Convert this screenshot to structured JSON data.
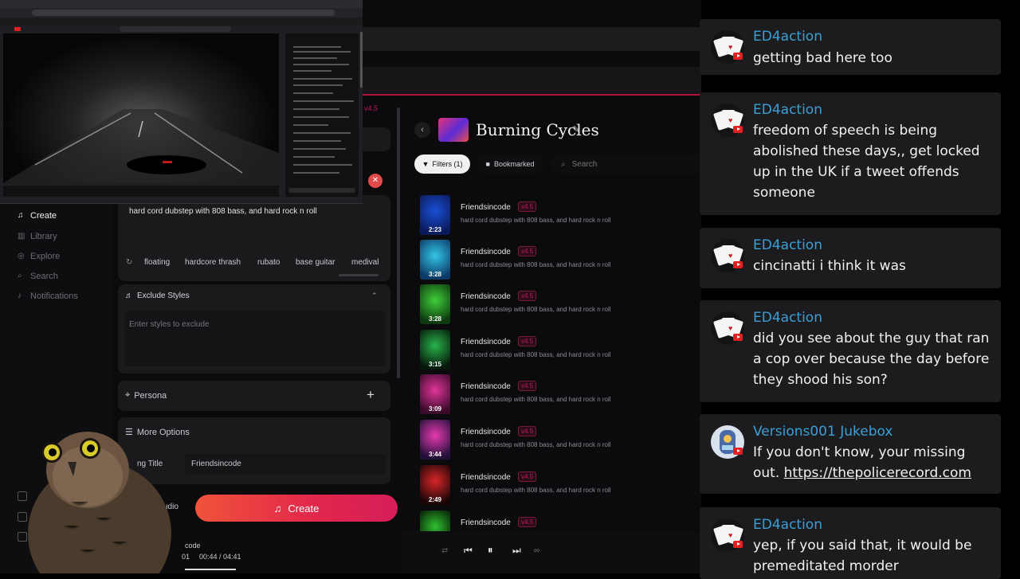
{
  "window": {
    "playlist_title": "Burning Cycles",
    "version_badge": "v4.5"
  },
  "sidebar": {
    "items": [
      {
        "label": "Create",
        "icon": "music-note-icon",
        "active": true
      },
      {
        "label": "Library",
        "icon": "library-icon"
      },
      {
        "label": "Explore",
        "icon": "compass-icon"
      },
      {
        "label": "Search",
        "icon": "search-icon"
      },
      {
        "label": "Notifications",
        "icon": "bell-icon"
      }
    ]
  },
  "form": {
    "prompt_text": "hard cord dubstep with 808 bass, and hard rock n roll",
    "style_tags": [
      "floating",
      "hardcore thrash",
      "rubato",
      "base guitar",
      "medival"
    ],
    "exclude_styles_label": "Exclude Styles",
    "exclude_placeholder": "Enter styles to exclude",
    "persona_label": "Persona",
    "more_options_label": "More Options",
    "song_title_label": "ng Title",
    "song_title_value": "Friendsincode",
    "audio_label": "udio",
    "create_label": "Create",
    "player_track_fragment": "code",
    "player_time": "00:44 / 04:41",
    "player_index": "01"
  },
  "toolbar": {
    "filters_label": "Filters (1)",
    "bookmarked_label": "Bookmarked",
    "search_placeholder": "Search"
  },
  "songs": [
    {
      "title": "Friendsincode",
      "badge": "v4.5",
      "desc": "hard cord dubstep with 808 bass, and hard rock n roll",
      "duration": "2:23",
      "color1": "#1a4fd6",
      "color2": "#0a1a5a"
    },
    {
      "title": "Friendsincode",
      "badge": "v4.5",
      "desc": "hard cord dubstep with 808 bass, and hard rock n roll",
      "duration": "3:28",
      "color1": "#33c6e8",
      "color2": "#0c3a66"
    },
    {
      "title": "Friendsincode",
      "badge": "v4.5",
      "desc": "hard cord dubstep with 808 bass, and hard rock n roll",
      "duration": "3:28",
      "color1": "#3fcf3a",
      "color2": "#0d3a0f"
    },
    {
      "title": "Friendsincode",
      "badge": "v4.5",
      "desc": "hard cord dubstep with 808 bass, and hard rock n roll",
      "duration": "3:15",
      "color1": "#28b24a",
      "color2": "#061a0c"
    },
    {
      "title": "Friendsincode",
      "badge": "v4.5",
      "desc": "hard cord dubstep with 808 bass, and hard rock n roll",
      "duration": "3:09",
      "color1": "#e0359a",
      "color2": "#3a0a2a"
    },
    {
      "title": "Friendsincode",
      "badge": "v4.5",
      "desc": "hard cord dubstep with 808 bass, and hard rock n roll",
      "duration": "3:44",
      "color1": "#e63ab0",
      "color2": "#23103a"
    },
    {
      "title": "Friendsincode",
      "badge": "v4.5",
      "desc": "hard cord dubstep with 808 bass, and hard rock n roll",
      "duration": "2:49",
      "color1": "#d8262a",
      "color2": "#1a0505"
    },
    {
      "title": "Friendsincode",
      "badge": "v4.5",
      "desc": "",
      "duration": "",
      "color1": "#2fbf2f",
      "color2": "#051405"
    }
  ],
  "chat": [
    {
      "author": "ED4action",
      "text": "getting bad here too"
    },
    {
      "author": "ED4action",
      "text": "freedom of speech is being abolished these days,, get locked up in the UK if a tweet offends someone"
    },
    {
      "author": "ED4action",
      "text": "cincinatti i think it was"
    },
    {
      "author": "ED4action",
      "text": "did you see about the guy that ran a cop over because the day before they shood his son?"
    },
    {
      "author": "Versions001 Jukebox",
      "text": "If you don't know, your missing out.",
      "link": "https://thepolicerecord.com"
    },
    {
      "author": "ED4action",
      "text": "yep, if you said that, it would be premeditated morder"
    }
  ],
  "colors": {
    "accent": "#e2264c",
    "chat_author": "#3b9fd6",
    "chat_bg": "#1c1c1e"
  }
}
